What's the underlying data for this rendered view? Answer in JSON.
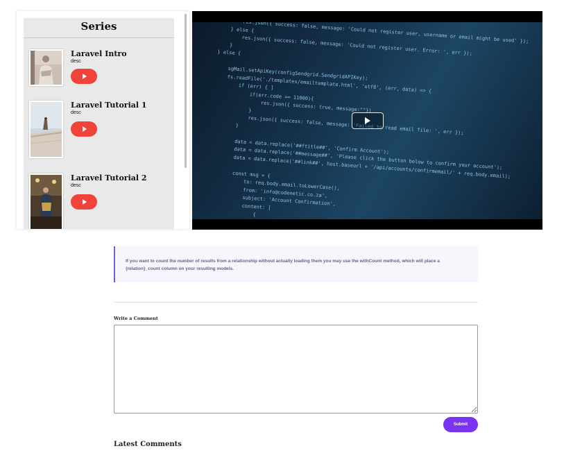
{
  "series": {
    "title": "Series",
    "items": [
      {
        "title": "Laravel Intro",
        "desc": "desc",
        "thumb_icon": "person-photo-thumbnail"
      },
      {
        "title": "Laravel Tutorial 1",
        "desc": "desc",
        "thumb_icon": "landscape-photo-thumbnail"
      },
      {
        "title": "Laravel Tutorial 2",
        "desc": "desc",
        "thumb_icon": "person-photo-thumbnail"
      }
    ],
    "accent_color": "#f0443a"
  },
  "video": {
    "play_icon": "play-icon"
  },
  "quote": {
    "text": "If you want to count the number of results from a relationship without actually loading them you may use the withCount method, which will place a {relation}_count column on your resulting models."
  },
  "comment": {
    "label": "Write a Comment",
    "placeholder": "",
    "value": "",
    "submit_label": "Submit",
    "submit_color": "#7a33f0"
  },
  "latest_comments": {
    "title": "Latest Comments"
  }
}
